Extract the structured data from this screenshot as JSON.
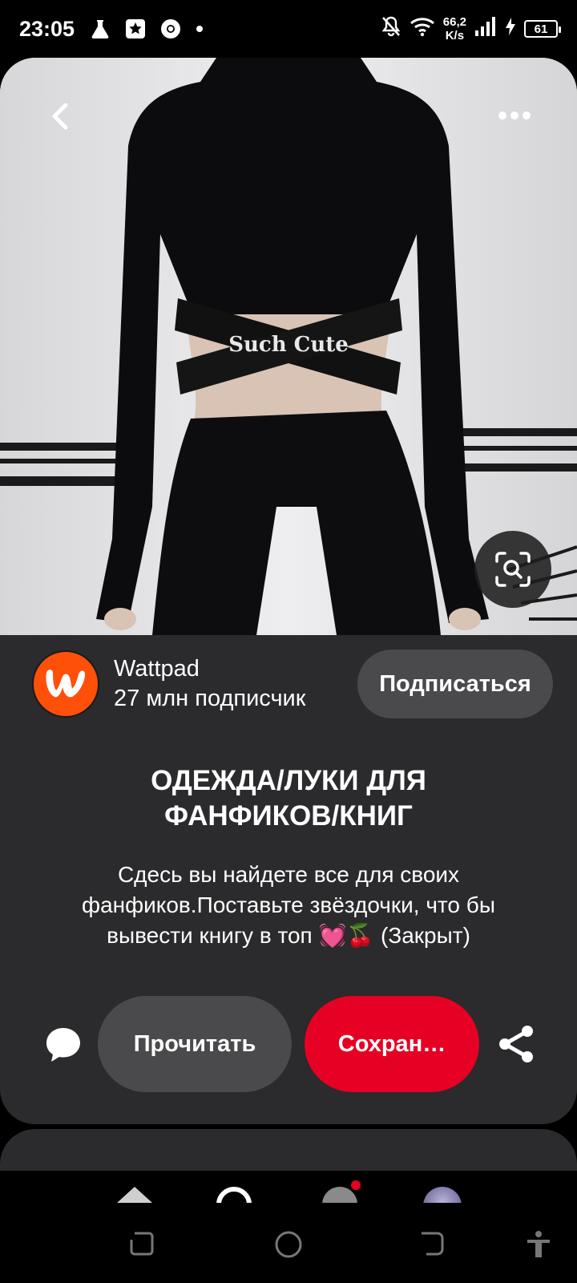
{
  "status_bar": {
    "time": "23:05",
    "net_speed_value": "66,2",
    "net_speed_unit": "K/s",
    "battery": "61",
    "icons": [
      "flask-icon",
      "star-box-icon",
      "chrome-icon",
      "dot-icon",
      "mute-icon",
      "wifi-icon",
      "signal-icon",
      "charging-icon"
    ]
  },
  "pin": {
    "image_label": "Such Cute",
    "creator": {
      "name": "Wattpad",
      "subscribers": "27 млн подписчик",
      "follow_label": "Подписаться",
      "avatar_color": "#ff500a"
    },
    "title_line1": "ОДЕЖДА/ЛУКИ ДЛЯ",
    "title_line2": "ФАНФИКОВ/КНИГ",
    "description_line1": "Сдесь вы найдете все для своих",
    "description_line2": "фанфиков.Поставьте звёздочки, что бы",
    "description_line3": "вывести книгу в топ 💓🍒 (Закрыт)",
    "actions": {
      "read_label": "Прочитать",
      "save_label": "Сохран…"
    }
  },
  "colors": {
    "card_bg": "#2b2a2c",
    "button_gray": "#4a494b",
    "save_red": "#e60023"
  }
}
